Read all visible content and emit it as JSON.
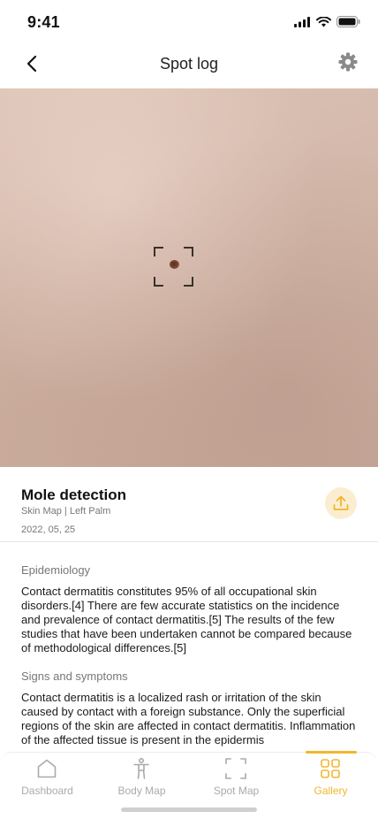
{
  "status_bar": {
    "time": "9:41"
  },
  "nav": {
    "title": "Spot log"
  },
  "detail": {
    "title": "Mole detection",
    "subtitle": "Skin Map | Left Palm",
    "date": "2022, 05, 25"
  },
  "article": {
    "sections": [
      {
        "heading": "Epidemiology",
        "body": "Contact dermatitis constitutes 95% of all occupational skin disorders.[4] There are few accurate statistics on the incidence and prevalence of contact dermatitis.[5] The results of the few studies that have been undertaken cannot be compared because of methodological differences.[5]"
      },
      {
        "heading": "Signs and symptoms",
        "body": "Contact dermatitis is a localized rash or irritation of the skin caused by contact with a foreign substance. Only the superficial regions of the skin are affected in contact dermatitis. Inflammation of the affected tissue is present in the epidermis"
      }
    ]
  },
  "tabs": [
    {
      "label": "Dashboard",
      "icon": "home-icon",
      "active": false
    },
    {
      "label": "Body Map",
      "icon": "body-icon",
      "active": false
    },
    {
      "label": "Spot Map",
      "icon": "scan-icon",
      "active": false
    },
    {
      "label": "Gallery",
      "icon": "grid-icon",
      "active": true
    }
  ],
  "colors": {
    "accent": "#f0b72e",
    "accent_soft": "#fbeed0",
    "inactive": "#aaaaaa"
  }
}
